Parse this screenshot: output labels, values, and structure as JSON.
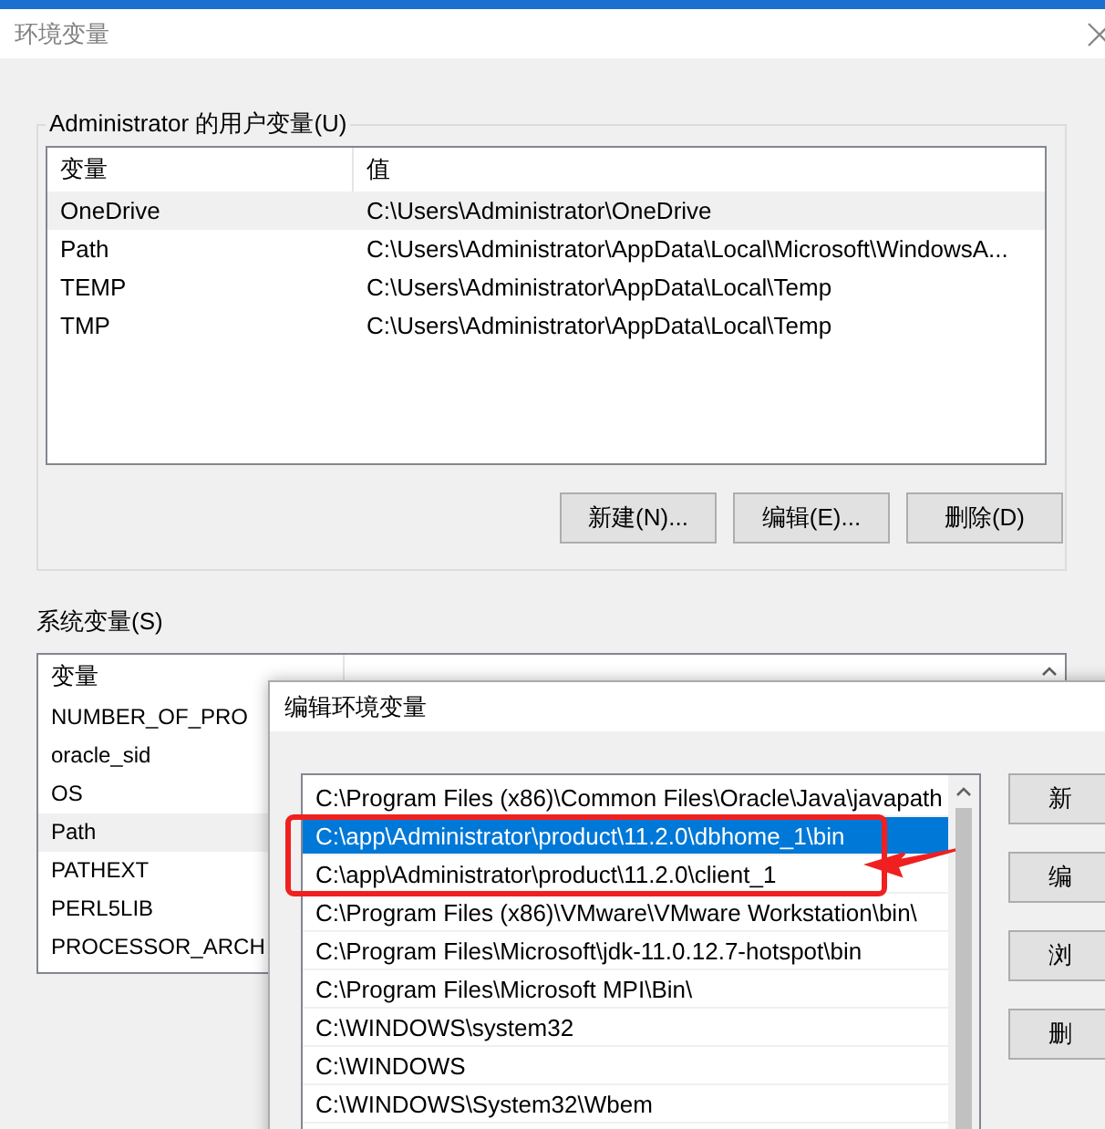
{
  "window": {
    "title": "环境变量"
  },
  "user_variables": {
    "label": "Administrator 的用户变量(U)",
    "columns": [
      "变量",
      "值"
    ],
    "rows": [
      {
        "name": "OneDrive",
        "value": "C:\\Users\\Administrator\\OneDrive",
        "selected": true
      },
      {
        "name": "Path",
        "value": "C:\\Users\\Administrator\\AppData\\Local\\Microsoft\\WindowsA...",
        "selected": false
      },
      {
        "name": "TEMP",
        "value": "C:\\Users\\Administrator\\AppData\\Local\\Temp",
        "selected": false
      },
      {
        "name": "TMP",
        "value": "C:\\Users\\Administrator\\AppData\\Local\\Temp",
        "selected": false
      }
    ],
    "buttons": [
      "新建(N)...",
      "编辑(E)...",
      "删除(D)"
    ]
  },
  "system_variables": {
    "label": "系统变量(S)",
    "columns": [
      "变量"
    ],
    "rows": [
      {
        "name": "NUMBER_OF_PRO",
        "selected": false
      },
      {
        "name": "oracle_sid",
        "selected": false
      },
      {
        "name": "OS",
        "selected": false
      },
      {
        "name": "Path",
        "selected": true
      },
      {
        "name": "PATHEXT",
        "selected": false
      },
      {
        "name": "PERL5LIB",
        "selected": false
      },
      {
        "name": "PROCESSOR_ARCH",
        "selected": false
      }
    ]
  },
  "edit_dialog": {
    "title": "编辑环境变量",
    "entries": [
      {
        "text": "C:\\Program Files (x86)\\Common Files\\Oracle\\Java\\javapath",
        "selected": false
      },
      {
        "text": "C:\\app\\Administrator\\product\\11.2.0\\dbhome_1\\bin",
        "selected": true
      },
      {
        "text": "C:\\app\\Administrator\\product\\11.2.0\\client_1",
        "selected": false
      },
      {
        "text": "C:\\Program Files (x86)\\VMware\\VMware Workstation\\bin\\",
        "selected": false
      },
      {
        "text": "C:\\Program Files\\Microsoft\\jdk-11.0.12.7-hotspot\\bin",
        "selected": false
      },
      {
        "text": "C:\\Program Files\\Microsoft MPI\\Bin\\",
        "selected": false
      },
      {
        "text": "C:\\WINDOWS\\system32",
        "selected": false
      },
      {
        "text": "C:\\WINDOWS",
        "selected": false
      },
      {
        "text": "C:\\WINDOWS\\System32\\Wbem",
        "selected": false
      }
    ],
    "buttons": [
      "新",
      "编",
      "浏",
      "删"
    ]
  }
}
